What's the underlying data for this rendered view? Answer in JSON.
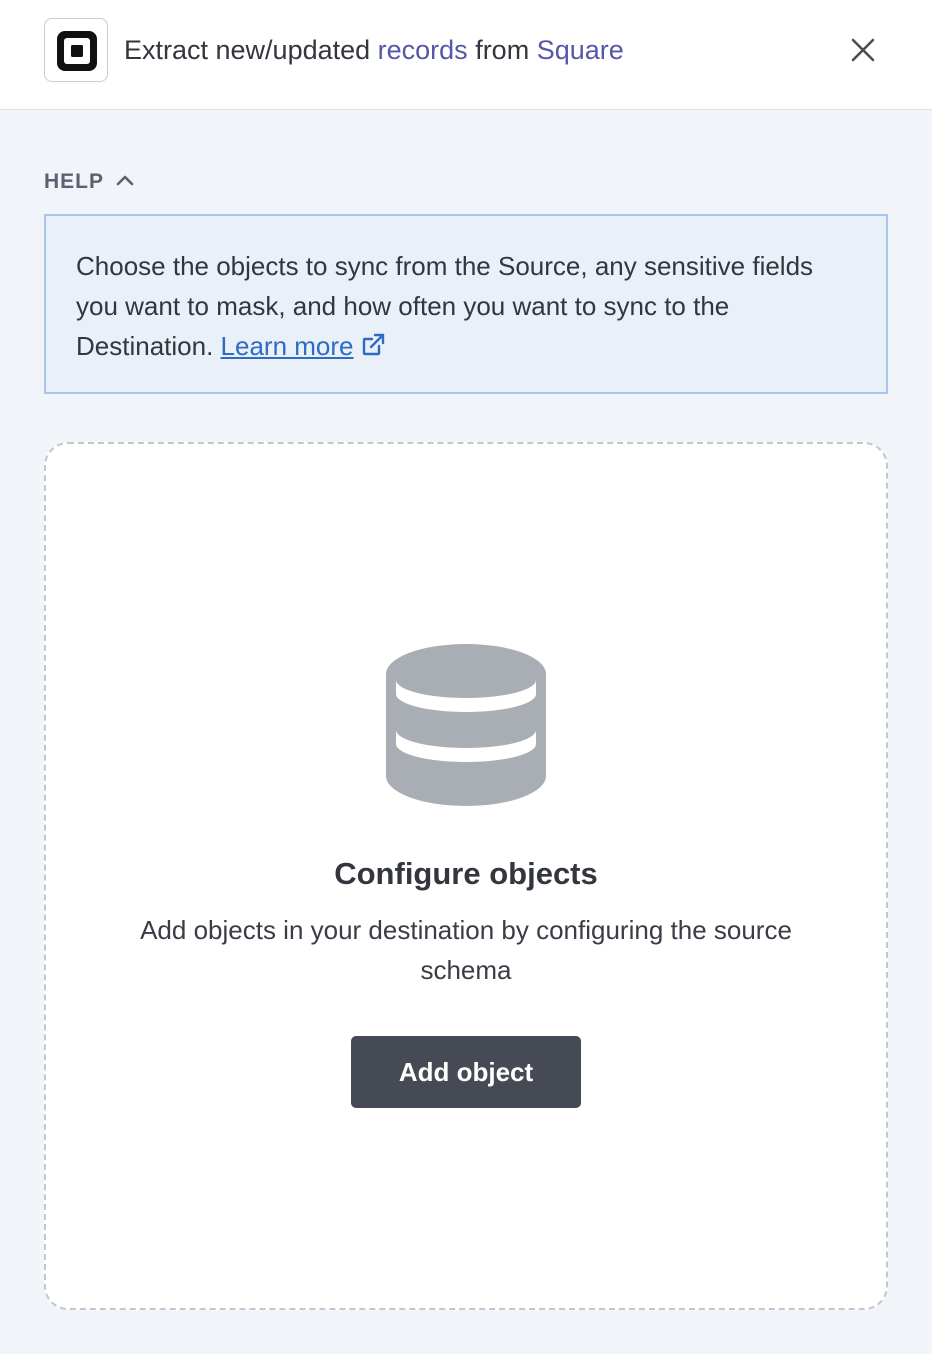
{
  "header": {
    "title_prefix": "Extract new/updated ",
    "title_records": "records",
    "title_middle": " from ",
    "title_source": "Square",
    "logo_icon": "square-logo-icon",
    "close_icon": "close-icon"
  },
  "help": {
    "label": "HELP",
    "chevron_icon": "chevron-up-icon",
    "text": "Choose the objects to sync from the Source, any sensitive fields you want to mask, and how often you want to sync to the Destination. ",
    "link_text": "Learn more",
    "link_icon": "external-link-icon"
  },
  "empty_state": {
    "icon": "database-icon",
    "title": "Configure objects",
    "description": "Add objects in your destination by configuring the source schema",
    "button_label": "Add object"
  },
  "colors": {
    "accent": "#5557a8",
    "link": "#2d6bc4",
    "button_bg": "#464a54",
    "help_bg": "#e9f0f8",
    "help_border": "#a7c6ee"
  }
}
